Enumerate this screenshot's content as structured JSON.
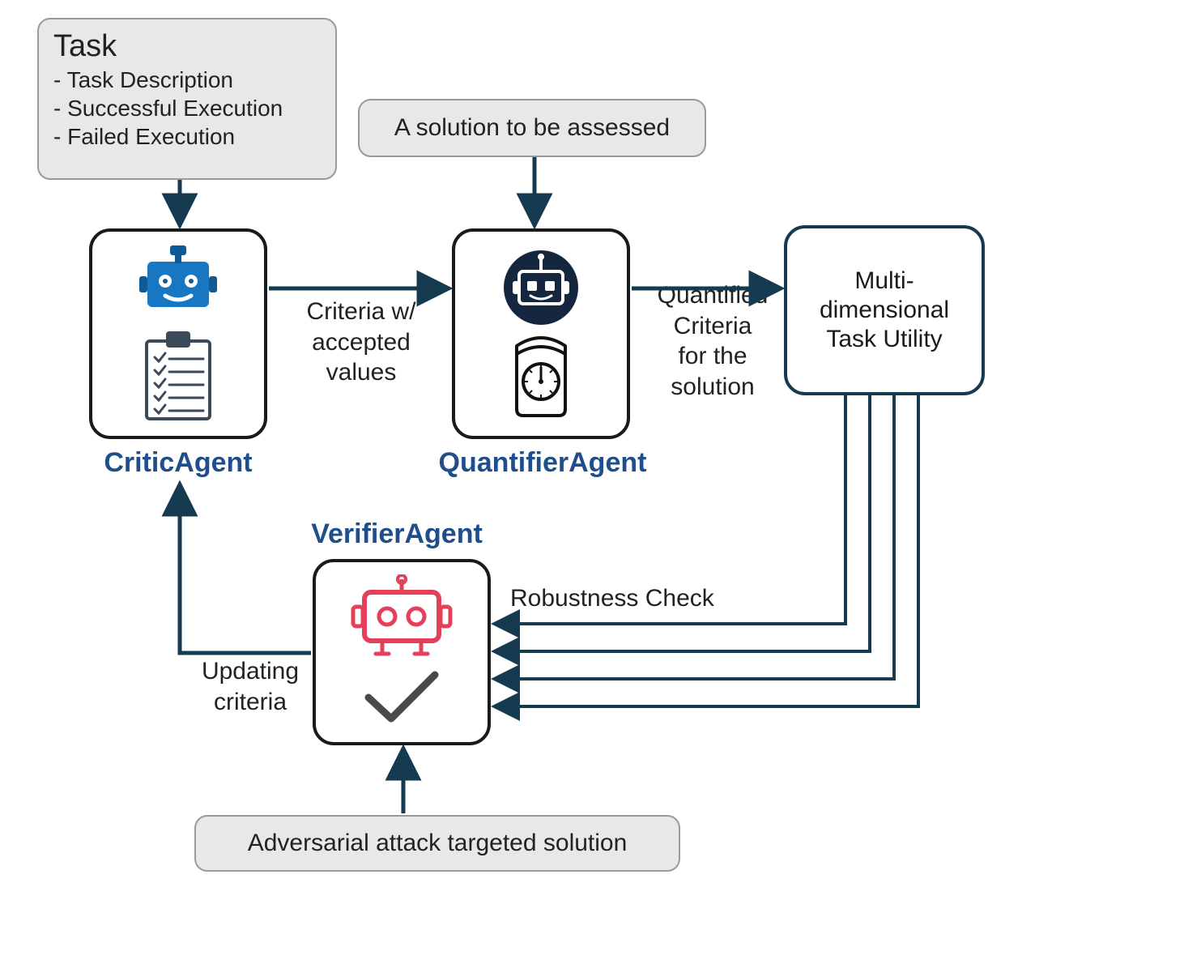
{
  "task_box": {
    "title": "Task",
    "lines": [
      "- Task Description",
      "-  Successful Execution",
      "- Failed Execution"
    ]
  },
  "solution_box": {
    "text": "A solution to be assessed"
  },
  "adversarial_box": {
    "text": "Adversarial attack targeted solution"
  },
  "utility_box": {
    "text": "Multi-\ndimensional\nTask Utility"
  },
  "agents": {
    "critic": "CriticAgent",
    "quantifier": "QuantifierAgent",
    "verifier": "VerifierAgent"
  },
  "labels": {
    "criteria": "Criteria w/\naccepted\nvalues",
    "quantified": "Quantified\nCriteria\nfor the\nsolution",
    "robustness": "Robustness Check",
    "updating": "Updating\ncriteria"
  },
  "colors": {
    "gray_fill": "#e8e8e8",
    "gray_border": "#9a9a9a",
    "black": "#1a1a1a",
    "dark_teal": "#163a4f",
    "agent_label": "#1f4e8c",
    "critic_icon": "#1777c2",
    "quantifier_icon": "#14273f",
    "verifier_icon": "#e4405a"
  }
}
